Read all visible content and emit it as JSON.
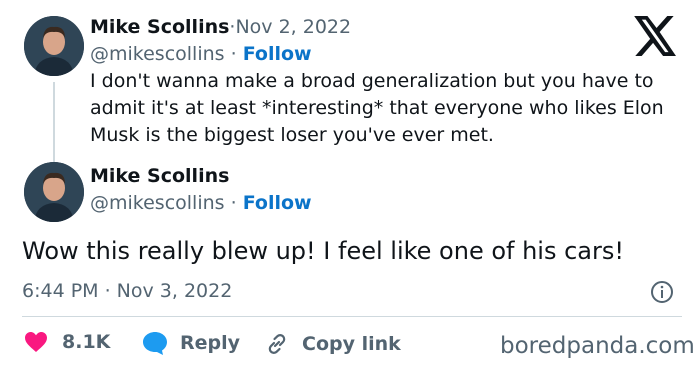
{
  "tweet1": {
    "author_name": "Mike Scollins",
    "separator": " · ",
    "date": "Nov 2, 2022",
    "handle": "@mikescollins",
    "follow_label": "Follow",
    "text": "I don't wanna make a broad generalization but you have to admit it's at least *interesting* that everyone who likes Elon Musk is the biggest loser you've ever met."
  },
  "tweet2": {
    "author_name": "Mike Scollins",
    "handle": "@mikescollins",
    "follow_label": "Follow",
    "text": "Wow this really blew up! I feel like one of his cars!",
    "timestamp": "6:44 PM · Nov 3, 2022"
  },
  "actions": {
    "like_count": "8.1K",
    "reply_label": "Reply",
    "copy_link_label": "Copy link"
  },
  "watermark": "boredpanda.com",
  "icons": {
    "logo": "x-logo-icon",
    "info": "info-icon",
    "like": "heart-icon",
    "reply": "reply-bubble-icon",
    "link": "link-icon"
  },
  "colors": {
    "heart": "#f91880",
    "reply": "#1d9bf0",
    "follow": "#0b74c9"
  }
}
